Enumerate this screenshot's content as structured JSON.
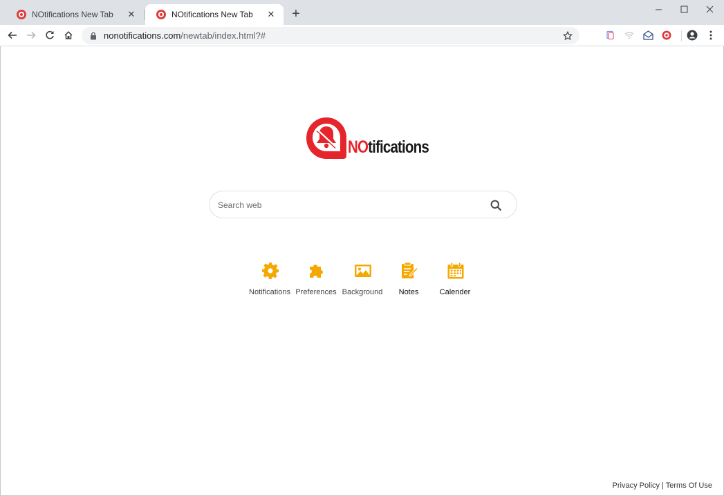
{
  "tabs": [
    {
      "title": "NOtifications New Tab"
    },
    {
      "title": "NOtifications New Tab"
    }
  ],
  "address_bar": {
    "domain": "nonotifications.com",
    "path": "/newtab/index.html?#"
  },
  "logo": {
    "prefix": "NO",
    "suffix": "tifications"
  },
  "search": {
    "placeholder": "Search web"
  },
  "shortcuts": [
    {
      "label": "Notifications",
      "icon": "gear-icon"
    },
    {
      "label": "Preferences",
      "icon": "puzzle-icon"
    },
    {
      "label": "Background",
      "icon": "image-icon"
    },
    {
      "label": "Notes",
      "icon": "notes-icon"
    },
    {
      "label": "Calender",
      "icon": "calendar-icon"
    }
  ],
  "footer": {
    "privacy": "Privacy Policy",
    "separator": "|",
    "terms": "Terms Of Use"
  },
  "colors": {
    "brand_red": "#e5252b",
    "shortcut_orange": "#f5a800",
    "tabstrip": "#dee1e6"
  }
}
